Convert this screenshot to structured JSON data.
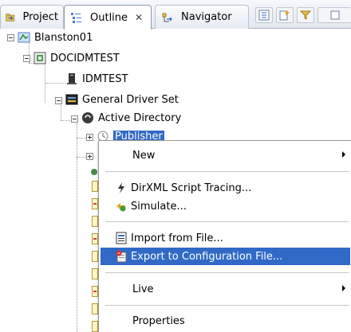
{
  "tabs": [
    {
      "label": "Project",
      "icon": "project-icon"
    },
    {
      "label": "Outline",
      "icon": "outline-icon",
      "close": "✕"
    },
    {
      "label": "Navigator",
      "icon": "navigator-icon"
    }
  ],
  "tree": {
    "root": "Blanston01",
    "vault": "DOCIDMTEST",
    "server": "IDMTEST",
    "driver_set": "General Driver Set",
    "driver": "Active Directory",
    "channel": "Publisher"
  },
  "context_menu": {
    "items": [
      {
        "label": "New",
        "has_submenu": true
      },
      {
        "label": "DirXML Script Tracing...",
        "icon": "lightning-icon"
      },
      {
        "label": "Simulate...",
        "icon": "simulate-icon"
      },
      {
        "label": "Import from File...",
        "icon": "import-icon"
      },
      {
        "label": "Export to Configuration File...",
        "icon": "export-icon",
        "highlighted": true
      },
      {
        "label": "Live",
        "has_submenu": true
      },
      {
        "label": "Properties"
      }
    ]
  },
  "colors": {
    "selection": "#3169c6",
    "tabbar": "#e3e8ef"
  }
}
